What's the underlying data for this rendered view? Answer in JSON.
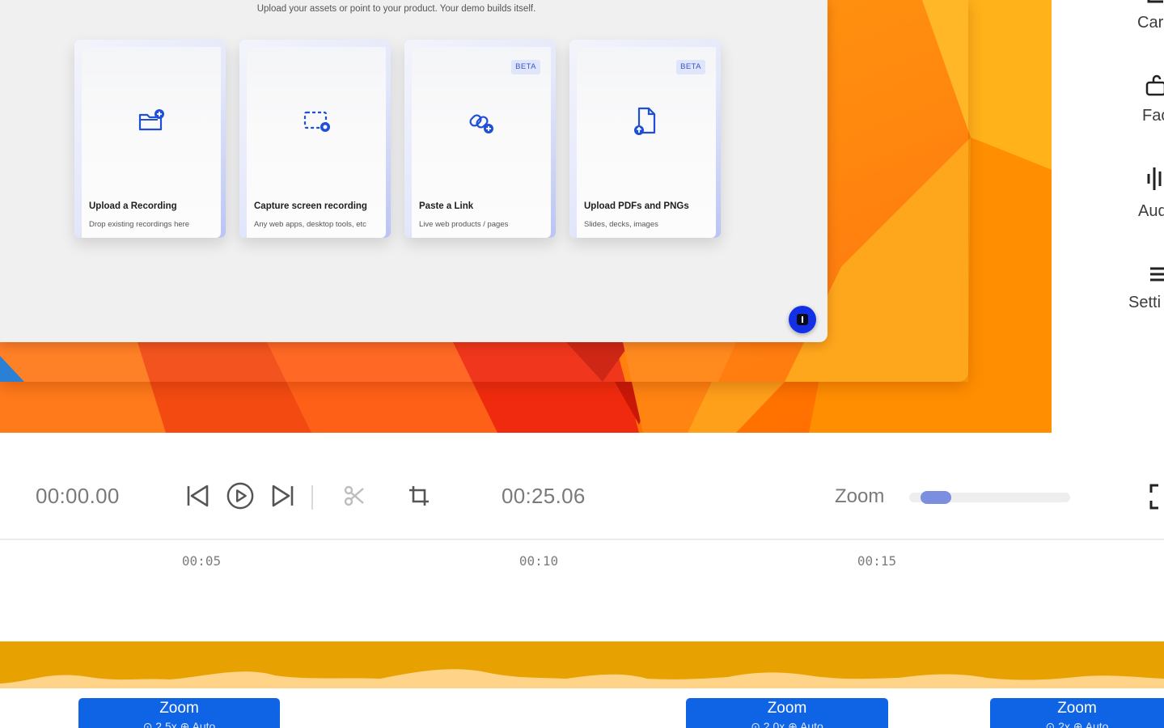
{
  "app_window": {
    "subtitle": "Upload your assets or point to your product. Your demo builds itself."
  },
  "cards": [
    {
      "title": "Upload a Recording",
      "description": "Drop existing recordings here",
      "icon": "folder-add-icon"
    },
    {
      "title": "Capture screen recording",
      "description": "Any web apps, desktop tools, etc",
      "icon": "screen-capture-icon"
    },
    {
      "title": "Paste a Link",
      "description": "Live web products / pages",
      "icon": "link-add-icon",
      "badge": "BETA"
    },
    {
      "title": "Upload PDFs and PNGs",
      "description": "Slides, decks, images",
      "icon": "file-upload-icon",
      "badge": "BETA"
    }
  ],
  "side_panel": {
    "items": [
      {
        "label": "Car",
        "icon": "camera-icon"
      },
      {
        "label": "Fac",
        "icon": "face-icon"
      },
      {
        "label": "Aud",
        "icon": "audio-wave-icon"
      },
      {
        "label": "Setti",
        "icon": "settings-menu-icon"
      }
    ]
  },
  "controls": {
    "current_time": "00:00.00",
    "total_time": "00:25.06",
    "zoom_label": "Zoom",
    "zoom_level": 0.09
  },
  "timeline": {
    "ticks": [
      "00:05",
      "00:10",
      "00:15"
    ]
  },
  "zoom_segments": [
    {
      "label": "Zoom",
      "sub": "⊙ 2.5x  ⊕ Auto"
    },
    {
      "label": "Zoom",
      "sub": "⊙ 2.0x  ⊕ Auto"
    },
    {
      "label": "Zoom",
      "sub": "⊙ 2x  ⊕ Auto"
    }
  ],
  "colors": {
    "accent": "#0f64e6",
    "audio_track": "#e7a100",
    "zoom_slider": "#7b8edf",
    "card_icon": "#1f4fd6"
  }
}
